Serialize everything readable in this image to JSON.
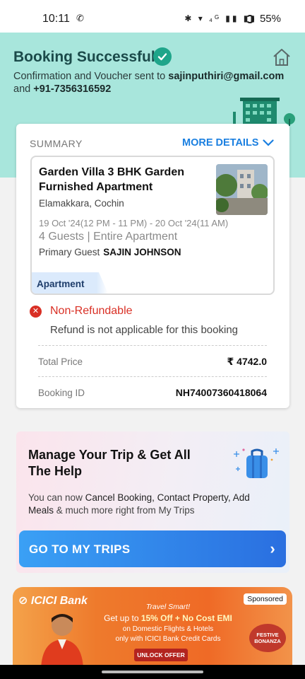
{
  "status_bar": {
    "time": "10:11",
    "icons": "✱ ▾ ₄ᴳ ▮▮ ▮▮",
    "battery": "55%"
  },
  "header": {
    "title": "Booking Successful",
    "confirmation_prefix": "Confirmation and Voucher sent to ",
    "email": "sajinputhiri@gmail.com",
    "and_text": " and ",
    "phone": "+91-7356316592"
  },
  "summary": {
    "label": "SUMMARY",
    "more_details": "MORE DETAILS",
    "property": {
      "name": "Garden Villa 3 BHK Garden Furnished Apartment",
      "location": "Elamakkara, Cochin",
      "dates": "19 Oct '24(12 PM - 11 PM) - 20 Oct '24(11 AM)",
      "guests": "4 Guests | Entire Apartment",
      "primary_guest_label": "Primary Guest",
      "primary_guest_name": "SAJIN JOHNSON",
      "tag": "Apartment"
    },
    "refund_title": "Non-Refundable",
    "refund_text": "Refund is not applicable for this booking",
    "total_price_label": "Total Price",
    "total_price_value": "₹ 4742.0",
    "booking_id_label": "Booking ID",
    "booking_id_value": "NH74007360418064"
  },
  "promo": {
    "title": "Manage Your Trip & Get All The Help",
    "desc_prefix": "You can now ",
    "desc_bold1": "Cancel Booking, Contact Property, Add Meals",
    "desc_suffix": " & much more right from My Trips",
    "button": "GO TO MY TRIPS"
  },
  "ad": {
    "bank": "ICICI Bank",
    "sponsored": "Sponsored",
    "line1": "Travel Smart!",
    "line2_prefix": "Get up to ",
    "line2_bold": "15% Off + No Cost EMI",
    "line3": "on Domestic Flights & Hotels",
    "line4": "only with ICICI Bank Credit Cards",
    "cta": "UNLOCK OFFER",
    "badge": "FESTIVE BONANZA"
  },
  "colors": {
    "hero_bg": "#a8e6dc",
    "accent_blue": "#1a7fe0",
    "error_red": "#d93025",
    "success_green": "#1fa58a"
  }
}
